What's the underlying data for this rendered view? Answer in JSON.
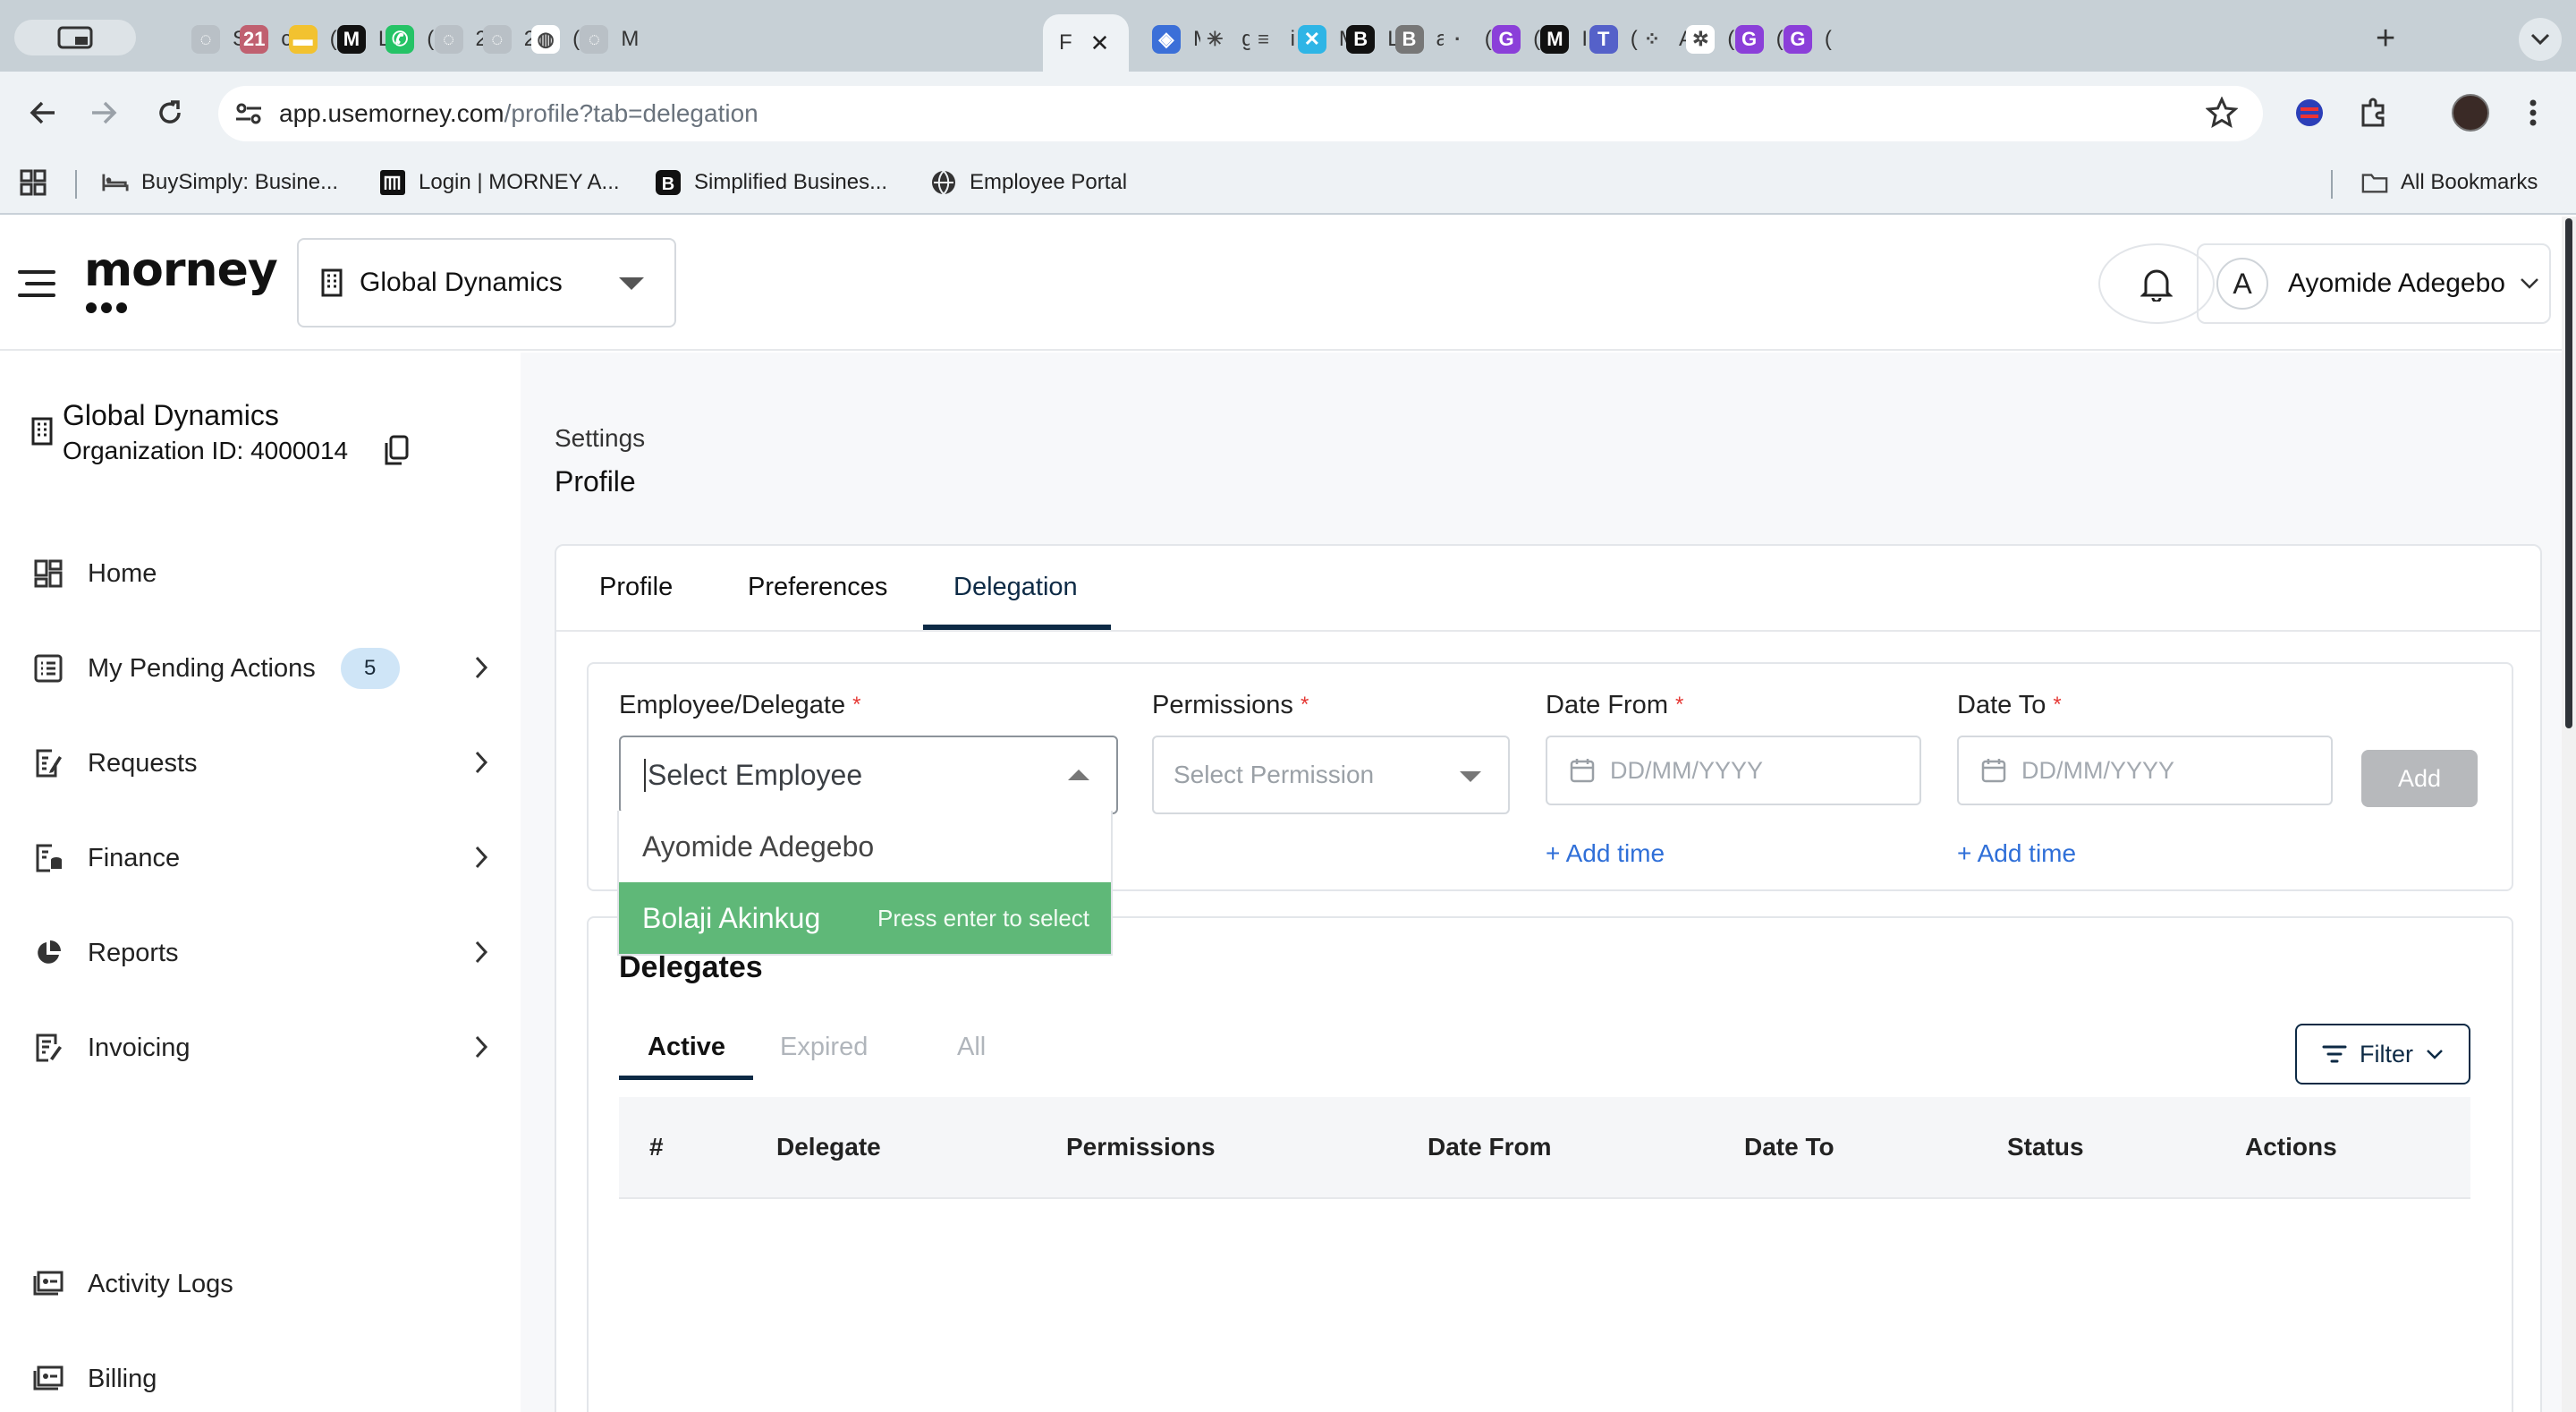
{
  "browser": {
    "tabs": [
      {
        "t": "S",
        "color": "#b9c0c6",
        "glyph": "◌"
      },
      {
        "t": "c",
        "color": "#c06070",
        "glyph": "21"
      },
      {
        "t": "(",
        "color": "#f2c230",
        "glyph": "▬"
      },
      {
        "t": "L",
        "color": "#111111",
        "glyph": "M"
      },
      {
        "t": "(",
        "color": "#25c366",
        "glyph": "✆"
      },
      {
        "t": "2",
        "color": "#b9c0c6",
        "glyph": "◌"
      },
      {
        "t": "2",
        "color": "#b9c0c6",
        "glyph": "◌"
      },
      {
        "t": "(",
        "color": "#ffffff",
        "glyph": "◍"
      },
      {
        "t": "M",
        "color": "#b9c0c6",
        "glyph": "◌"
      },
      {
        "t": "F",
        "color": "#eef2f5",
        "glyph": ""
      },
      {
        "t": "M",
        "color": "#3b6fd8",
        "glyph": "◈"
      },
      {
        "t": "g",
        "color": "#c7d0d6",
        "glyph": "✳"
      },
      {
        "t": "i",
        "color": "#c7d0d6",
        "glyph": "≡"
      },
      {
        "t": "M",
        "color": "#2eb5e6",
        "glyph": "✕"
      },
      {
        "t": "L",
        "color": "#111111",
        "glyph": "B"
      },
      {
        "t": "a",
        "color": "#777777",
        "glyph": "B"
      },
      {
        "t": "(",
        "color": "#c7d0d6",
        "glyph": "·"
      },
      {
        "t": "(",
        "color": "#8b3fd9",
        "glyph": "G"
      },
      {
        "t": "I",
        "color": "#111111",
        "glyph": "M"
      },
      {
        "t": "(",
        "color": "#5561c9",
        "glyph": "T"
      },
      {
        "t": "A",
        "color": "#c7d0d6",
        "glyph": "⁘"
      },
      {
        "t": "(",
        "color": "#ffffff",
        "glyph": "✲"
      },
      {
        "t": "(",
        "color": "#8b3fd9",
        "glyph": "G"
      },
      {
        "t": "(",
        "color": "#8b3fd9",
        "glyph": "G"
      }
    ],
    "url_host": "app.usemorney.com",
    "url_path": "/profile?tab=delegation",
    "bookmarks": [
      "BuySimply: Busine...",
      "Login | MORNEY A...",
      "Simplified Busines...",
      "Employee Portal"
    ],
    "all_bookmarks": "All Bookmarks"
  },
  "header": {
    "logo": "morney",
    "org_select": "Global Dynamics",
    "avatar_letter": "A",
    "user_name": "Ayomide Adegebo"
  },
  "sidebar": {
    "org_name": "Global Dynamics",
    "org_id": "Organization ID: 4000014",
    "items": [
      {
        "label": "Home"
      },
      {
        "label": "My Pending Actions",
        "badge": "5"
      },
      {
        "label": "Requests"
      },
      {
        "label": "Finance"
      },
      {
        "label": "Reports"
      },
      {
        "label": "Invoicing"
      },
      {
        "label": "Activity Logs"
      },
      {
        "label": "Billing"
      }
    ]
  },
  "main": {
    "breadcrumb": "Settings",
    "title": "Profile",
    "tabs": [
      "Profile",
      "Preferences",
      "Delegation"
    ],
    "form": {
      "employee_label": "Employee/Delegate",
      "employee_placeholder": "Select Employee",
      "permissions_label": "Permissions",
      "permissions_placeholder": "Select Permission",
      "date_from_label": "Date From",
      "date_to_label": "Date To",
      "date_placeholder": "DD/MM/YYYY",
      "add_time": "+ Add time",
      "add_button": "Add",
      "required_mark": "*"
    },
    "dropdown_options": [
      "Ayomide Adegebo",
      "Bolaji Akinkug"
    ],
    "dropdown_hint": "Press enter to select",
    "delegates": {
      "title": "Delegates",
      "subtabs": [
        "Active",
        "Expired",
        "All"
      ],
      "filter": "Filter",
      "columns": [
        "#",
        "Delegate",
        "Permissions",
        "Date From",
        "Date To",
        "Status",
        "Actions"
      ]
    }
  }
}
